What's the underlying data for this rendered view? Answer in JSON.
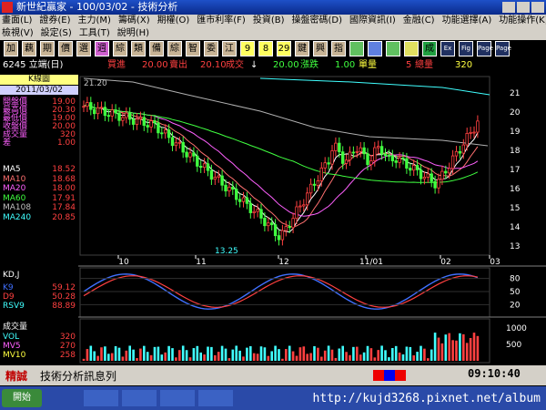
{
  "window": {
    "title": "新世紀贏家 - 100/03/02 - 技術分析"
  },
  "menu": {
    "row1": [
      "畫面(L)",
      "證券(E)",
      "主力(M)",
      "籌碼(X)",
      "期權(O)",
      "匯市利率(F)",
      "投資(B)",
      "操盤密碼(D)",
      "國際資訊(I)",
      "金融(C)",
      "功能選擇(A)",
      "功能操作(K)"
    ],
    "row2": [
      "檢視(V)",
      "設定(S)",
      "工具(T)",
      "說明(H)"
    ]
  },
  "toolbar": {
    "buttons": [
      "加",
      "藕",
      "期",
      "價",
      "選",
      "週",
      "綜",
      "類",
      "備",
      "綜",
      "智",
      "委",
      "江",
      "9",
      "8",
      "29",
      "鍵",
      "興",
      "指",
      "",
      "",
      "",
      "",
      "成",
      "Ex",
      "Fig",
      "Page",
      "Page"
    ]
  },
  "stock": {
    "code_label": "6245 立端(日)",
    "buy_label": "買進",
    "buy_price": "20.00",
    "sell_label": "賣出",
    "sell_price": "20.10",
    "trade_label": "成交",
    "arrow": "↓",
    "change_value": "20.00",
    "change_label": "漲跌",
    "vol_value": "1.00",
    "vol_label": "單量",
    "total_vol_value": "5",
    "total_vol_label": "總量",
    "total": "320"
  },
  "left_panel": {
    "header": "K線圖",
    "date": "2011/03/02",
    "quote": [
      {
        "k": "開盤價",
        "v": "19.00"
      },
      {
        "k": "最高價",
        "v": "20.30"
      },
      {
        "k": "最低價",
        "v": "19.00"
      },
      {
        "k": "收盤價",
        "v": "20.00"
      },
      {
        "k": "成交量",
        "v": "320"
      },
      {
        "k": "差",
        "v": "1.00"
      }
    ],
    "ma": [
      {
        "k": "MA5",
        "v": "18.52",
        "color": "#ffffff"
      },
      {
        "k": "MA10",
        "v": "18.68",
        "color": "#ff7070"
      },
      {
        "k": "MA20",
        "v": "18.00",
        "color": "#ff60ff"
      },
      {
        "k": "MA60",
        "v": "17.91",
        "color": "#40ff40"
      },
      {
        "k": "MA108",
        "v": "17.84",
        "color": "#c0c0c0"
      },
      {
        "k": "MA240",
        "v": "20.85",
        "color": "#40ffff"
      }
    ],
    "kd_header": "KD,J",
    "kd": [
      {
        "k": "K9",
        "v": "59.12",
        "color": "#4070ff"
      },
      {
        "k": "D9",
        "v": "50.28",
        "color": "#ff4040"
      },
      {
        "k": "RSV9",
        "v": "88.89",
        "color": "#40ffff"
      }
    ],
    "vol_header": "成交量",
    "vol": [
      {
        "k": "VOL",
        "v": "320",
        "color": "#40ffff"
      },
      {
        "k": "MV5",
        "v": "270",
        "color": "#ff60ff"
      },
      {
        "k": "MV10",
        "v": "258",
        "color": "#ffff40"
      }
    ]
  },
  "chart": {
    "x_ticks": [
      "10",
      "11",
      "12",
      "11/01",
      "02",
      "03"
    ],
    "price_ticks": [
      "21",
      "20",
      "19",
      "18",
      "17",
      "16",
      "15",
      "14",
      "13"
    ],
    "kd_ticks": [
      "80",
      "50",
      "20"
    ],
    "vol_ticks": [
      "1000",
      "500"
    ],
    "high_label": "21.20",
    "low_label": "13.25"
  },
  "bottom": {
    "tag": "精誠",
    "msg": "技術分析訊息列",
    "clock": "09:10:40"
  },
  "taskbar": {
    "start": "開始",
    "watermark": "http://kujd3268.pixnet.net/album"
  }
}
